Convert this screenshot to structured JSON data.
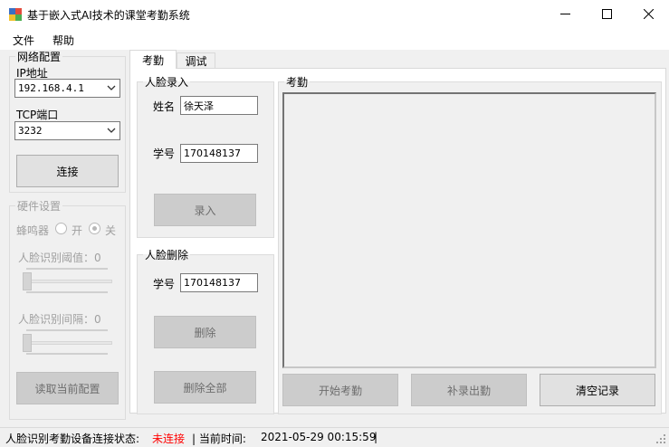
{
  "window": {
    "title": "基于嵌入式AI技术的课堂考勤系统",
    "minimize": "—",
    "maximize": "☐",
    "close": "✕"
  },
  "menu": {
    "items": [
      "文件",
      "帮助"
    ]
  },
  "network": {
    "group_label": "网络配置",
    "ip_label": "IP地址",
    "ip_value": "192.168.4.1",
    "port_label": "TCP端口",
    "port_value": "3232",
    "connect_button": "连接"
  },
  "hardware": {
    "group_label": "硬件设置",
    "buzzer_label": "蜂鸣器",
    "on_label": "开",
    "off_label": "关",
    "selected": "off",
    "threshold_label": "人脸识别阈值：0",
    "threshold_value": 0,
    "interval_label": "人脸识别间隔：0",
    "interval_value": 0,
    "read_config_button": "读取当前配置"
  },
  "tabs": [
    {
      "label": "考勤",
      "active": true
    },
    {
      "label": "调试",
      "active": false
    }
  ],
  "face_enroll": {
    "group_label": "人脸录入",
    "name_label": "姓名",
    "name_value": "徐天泽",
    "id_label": "学号",
    "id_value": "170148137",
    "enroll_button": "录入"
  },
  "face_delete": {
    "group_label": "人脸删除",
    "id_label": "学号",
    "id_value": "170148137",
    "delete_button": "删除",
    "delete_all_button": "删除全部"
  },
  "attendance": {
    "group_label": "考勤",
    "start_button": "开始考勤",
    "makeup_button": "补录出勤",
    "clear_button": "清空记录"
  },
  "status": {
    "conn_label": "人脸识别考勤设备连接状态:",
    "conn_value": "未连接",
    "time_label": "| 当前时间:",
    "time_value": "2021-05-29 00:15:59",
    "end_sep": "|",
    "conn_color": "#ff0000"
  },
  "icons": {
    "app": "app-icon",
    "dropdown": "chevron-down-icon"
  }
}
